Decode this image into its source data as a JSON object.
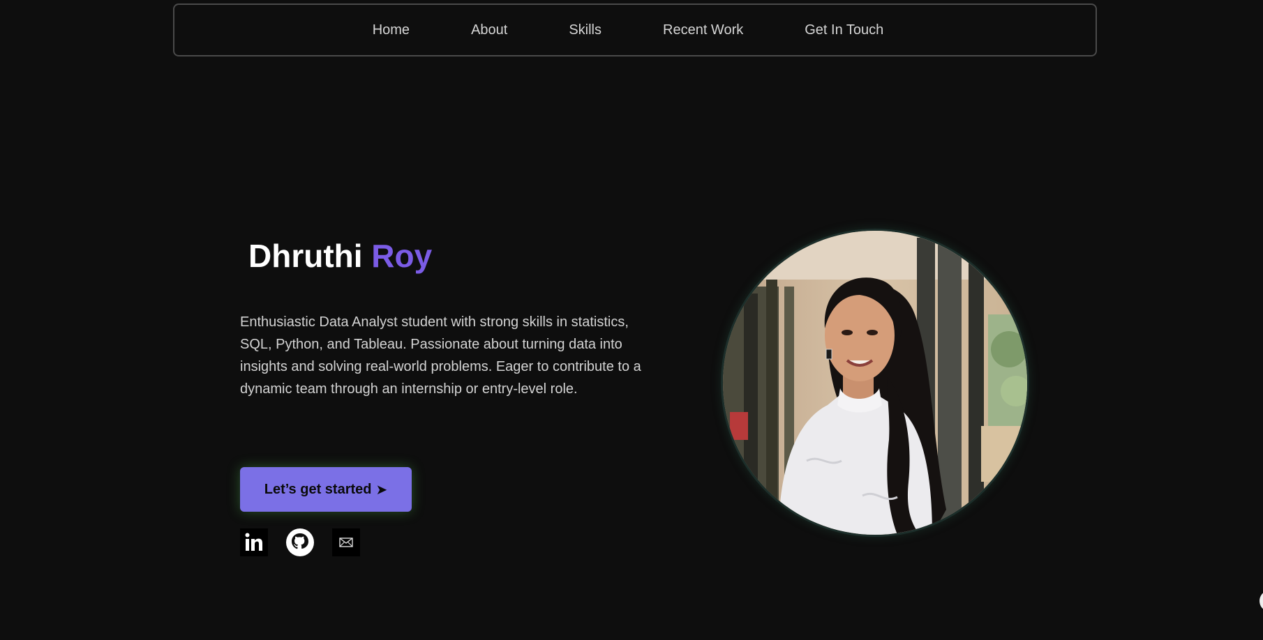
{
  "nav": {
    "items": [
      {
        "label": "Home"
      },
      {
        "label": "About"
      },
      {
        "label": "Skills"
      },
      {
        "label": "Recent Work"
      },
      {
        "label": "Get In Touch"
      }
    ]
  },
  "hero": {
    "first_name": "Dhruthi",
    "last_name": "Roy",
    "description": "Enthusiastic Data Analyst student with strong skills in statistics, SQL, Python, and Tableau. Passionate about turning data into insights and solving real-world problems. Eager to contribute to a dynamic team through an internship or entry-level role.",
    "cta_label": "Let’s get started",
    "cta_arrow": "➤"
  },
  "social": [
    {
      "icon": "linkedin-icon"
    },
    {
      "icon": "github-icon"
    },
    {
      "icon": "email-icon"
    }
  ],
  "colors": {
    "background": "#0e0e0e",
    "accent": "#7b5ce6",
    "button": "#7b70e6",
    "nav_border": "#4a4a4a",
    "text": "#d4d4d4"
  }
}
